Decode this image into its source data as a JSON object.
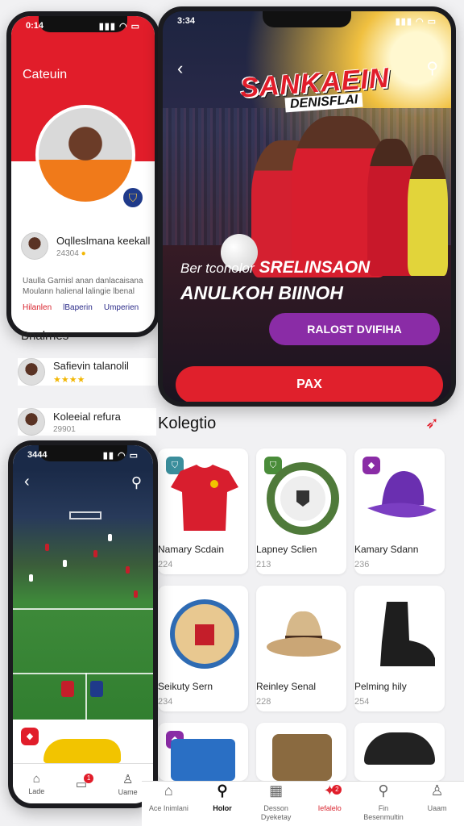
{
  "profile_screen": {
    "time": "0:14",
    "title": "Cateuin",
    "user1_name": "Oqlleslmana keekall",
    "user1_sub": "24304",
    "description": "Uaulla Garnisl anan danlacaisana Moulann halienal lalingie lbenal",
    "links": [
      "Hilanlen",
      "lBaperin",
      "Umperien"
    ],
    "section_title": "Bnalrnes",
    "list": [
      {
        "name": "Safievin talanolil",
        "sub": "★★★★"
      },
      {
        "name": "Koleeial refura",
        "sub": "29901"
      }
    ]
  },
  "hero_screen": {
    "time": "3:34",
    "logo_main": "SANKAEIN",
    "logo_sub": "DENISFLAI",
    "line1_small": "Ber tconolor",
    "line1_big": "SRELINSAON",
    "line2": "ANULKOH BIINOH",
    "secondary_button": "RALOST DVIFIHA",
    "primary_button": "PAX"
  },
  "collection": {
    "title": "Kolegtio",
    "items": [
      {
        "name": "Namary Scdain",
        "value": "224"
      },
      {
        "name": "Lapney Sclien",
        "value": "213"
      },
      {
        "name": "Kamary Sdann",
        "value": "236"
      },
      {
        "name": "Seikuty Sern",
        "value": "234"
      },
      {
        "name": "Reinley Senal",
        "value": "228"
      },
      {
        "name": "Pelming hily",
        "value": "254"
      }
    ]
  },
  "match_screen": {
    "time": "3444",
    "nav": [
      "Lade",
      "",
      "Uame"
    ],
    "notif_count": "1"
  },
  "bottom_nav": [
    {
      "label": "Ace Inimlani",
      "icon": "home-icon"
    },
    {
      "label": "Holor",
      "icon": "search-icon"
    },
    {
      "label": "Desson Dyeketay",
      "icon": "calendar-icon"
    },
    {
      "label": "Iefalelo",
      "icon": "tickets-icon"
    },
    {
      "label": "Fin Besenmultin",
      "icon": "search-icon"
    },
    {
      "label": "Uaam",
      "icon": "user-icon"
    }
  ],
  "bottom_notif": "2",
  "colors": {
    "brand_red": "#e11d2a",
    "purple": "#8a2ca6"
  }
}
